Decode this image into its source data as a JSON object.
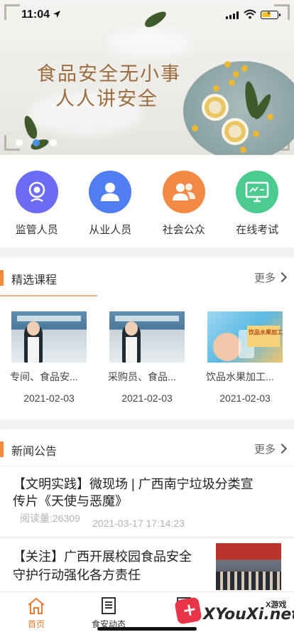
{
  "status_bar": {
    "time": "11:04"
  },
  "banner": {
    "slogan_line1": "食品安全无小事",
    "slogan_line2": "人人讲安全",
    "slide_count": 3,
    "active_slide": 2
  },
  "quick_entries": [
    {
      "label": "监管人员",
      "icon": "webcam-icon",
      "color": "#6b6cf3"
    },
    {
      "label": "从业人员",
      "icon": "person-icon",
      "color": "#4f7ef0"
    },
    {
      "label": "社会公众",
      "icon": "group-icon",
      "color": "#f28a45"
    },
    {
      "label": "在线考试",
      "icon": "monitor-icon",
      "color": "#4ccb8e"
    }
  ],
  "courses_section": {
    "title": "精选课程",
    "more_label": "更多",
    "items": [
      {
        "title": "专间、食品安...",
        "date": "2021-02-03"
      },
      {
        "title": "采购员、食品...",
        "date": "2021-02-03"
      },
      {
        "title": "饮品水果加工...",
        "date": "2021-02-03",
        "thumb_caption": "饮品水果加工"
      }
    ]
  },
  "news_section": {
    "title": "新闻公告",
    "more_label": "更多",
    "items": [
      {
        "title_line1": "【文明实践】微现场 | 广西南宁垃圾分类宣",
        "title_line2": "传片《天使与恶魔》",
        "reads": "阅读量:26309",
        "time": "2021-03-17 17:14:23"
      },
      {
        "title_line1": "【关注】广西开展校园食品安全",
        "title_line2": "守护行动强化各方责任"
      }
    ]
  },
  "tab_bar": {
    "tabs": [
      {
        "label": "首页",
        "icon": "home-icon",
        "active": true
      },
      {
        "label": "食安动态",
        "icon": "news-icon",
        "active": false
      },
      {
        "label": "",
        "icon": "profile-icon",
        "active": false
      }
    ]
  },
  "watermark": {
    "brand": "XYouXi.net",
    "tag": "X游戏"
  },
  "colors": {
    "accent": "#f08a3c",
    "active_tab": "#e87a2e",
    "slogan": "#9b6c3d"
  }
}
